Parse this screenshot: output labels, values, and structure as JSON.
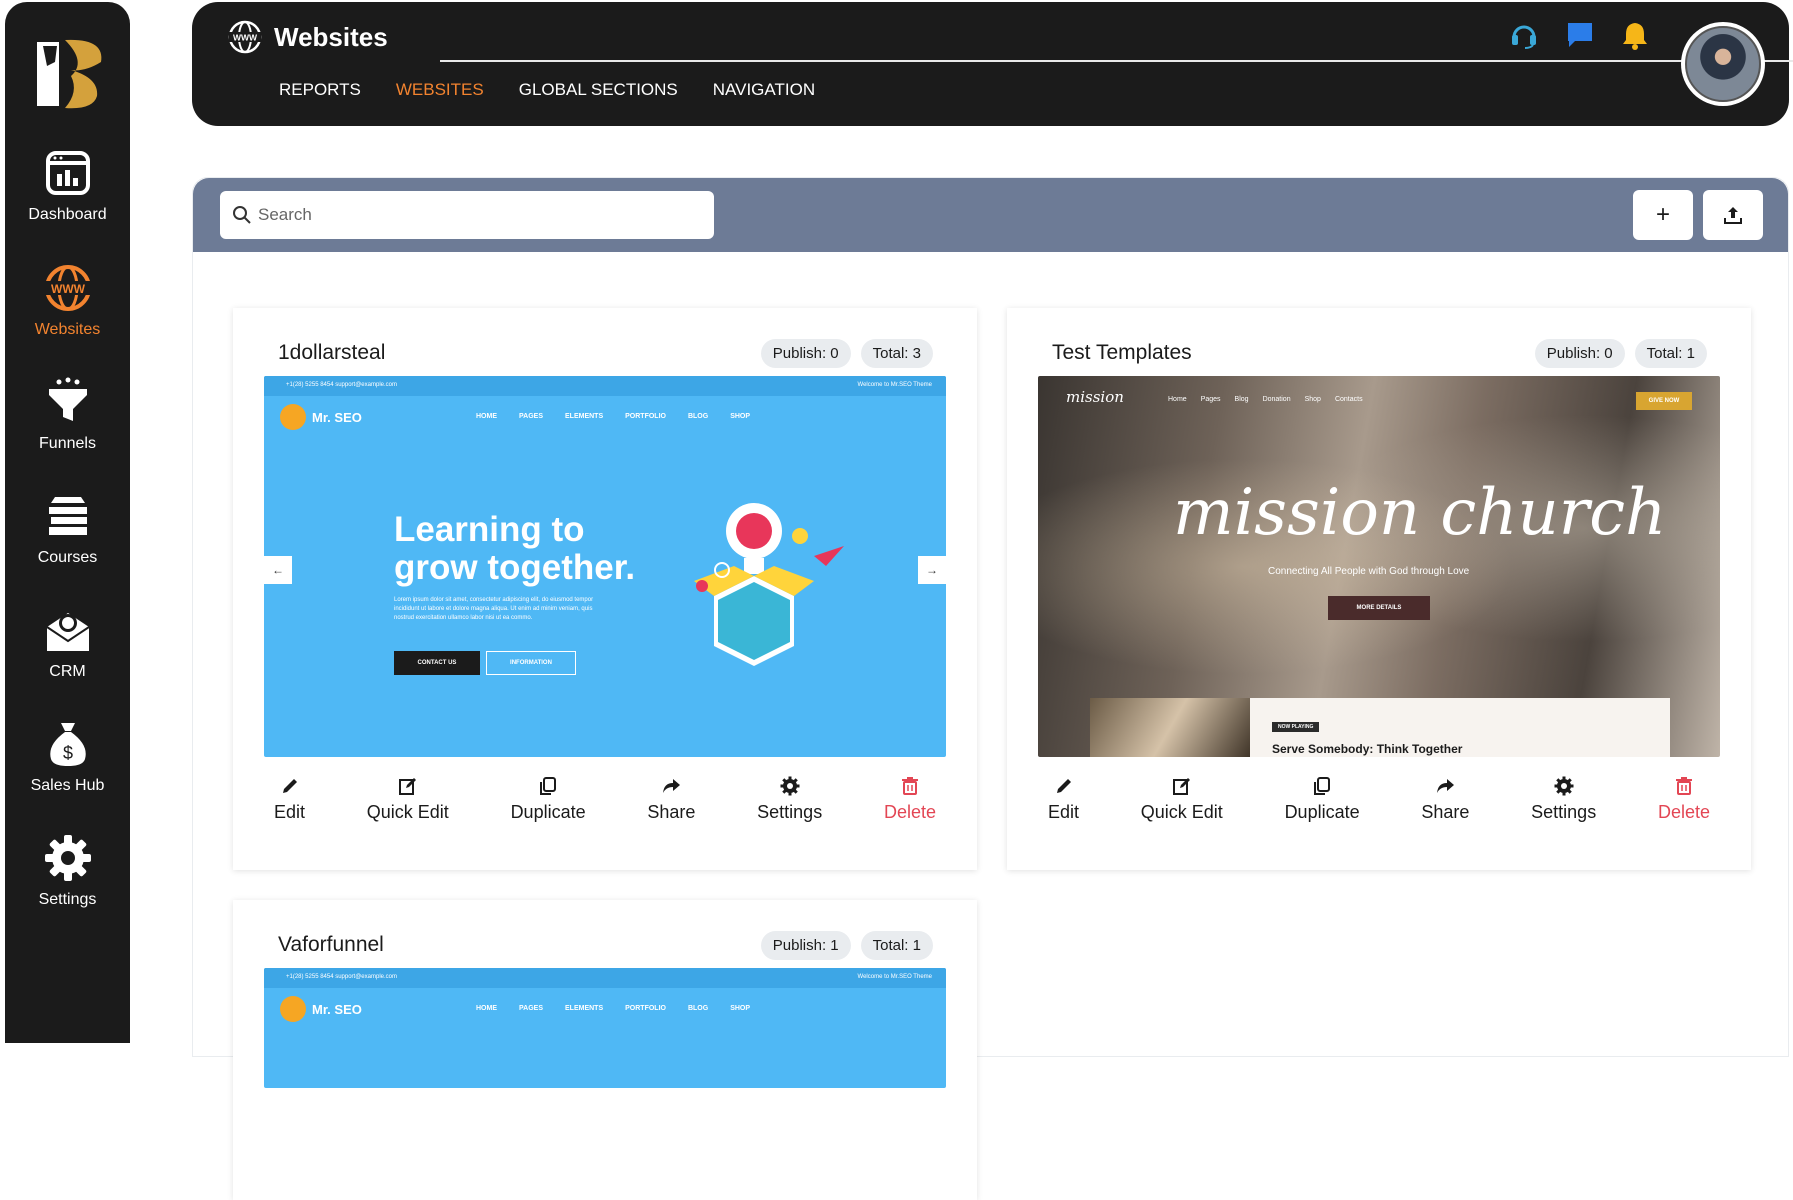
{
  "sidebar": {
    "items": [
      {
        "label": "Dashboard",
        "icon": "dashboard-icon"
      },
      {
        "label": "Websites",
        "icon": "www-globe-icon",
        "active": true
      },
      {
        "label": "Funnels",
        "icon": "funnel-icon"
      },
      {
        "label": "Courses",
        "icon": "books-icon"
      },
      {
        "label": "CRM",
        "icon": "crm-envelope-icon"
      },
      {
        "label": "Sales Hub",
        "icon": "money-bag-icon"
      },
      {
        "label": "Settings",
        "icon": "gear-icon"
      }
    ]
  },
  "header": {
    "title": "Websites",
    "tabs": [
      {
        "label": "REPORTS"
      },
      {
        "label": "WEBSITES",
        "active": true
      },
      {
        "label": "GLOBAL SECTIONS"
      },
      {
        "label": "NAVIGATION"
      }
    ]
  },
  "toolbar": {
    "search_placeholder": "Search",
    "add_label": "+",
    "upload_icon": "upload-icon"
  },
  "actions": {
    "edit": "Edit",
    "quick_edit": "Quick Edit",
    "duplicate": "Duplicate",
    "share": "Share",
    "settings": "Settings",
    "delete": "Delete"
  },
  "cards": [
    {
      "title": "1dollarsteal",
      "publish": "Publish: 0",
      "total": "Total: 3"
    },
    {
      "title": "Test Templates",
      "publish": "Publish: 0",
      "total": "Total: 1"
    },
    {
      "title": "Vaforfunnel",
      "publish": "Publish: 1",
      "total": "Total: 1"
    }
  ],
  "seo_preview": {
    "brand": "Mr. SEO",
    "menu": [
      "HOME",
      "PAGES",
      "ELEMENTS",
      "PORTFOLIO",
      "BLOG",
      "SHOP"
    ],
    "headline_1": "Learning to",
    "headline_2": "grow together.",
    "paragraph": "Lorem ipsum dolor sit amet, consectetur adipiscing elit, do eiusmod tempor incididunt ut labore et dolore magna aliqua. Ut enim ad minim veniam, quis nostrud exercitation ullamco labor nisi ut ea commo.",
    "btn_contact": "CONTACT US",
    "btn_info": "INFORMATION",
    "topbar_left": "+1(28) 5255 8454   support@example.com",
    "topbar_right": "Welcome to Mr.SEO Theme"
  },
  "church_preview": {
    "logo": "mission",
    "menu": [
      "Home",
      "Pages",
      "Blog",
      "Donation",
      "Shop",
      "Contacts"
    ],
    "give": "GIVE NOW",
    "script": "mission church",
    "tagline": "Connecting All People with God through Love",
    "more": "MORE DETAILS",
    "now_playing": "NOW PLAYING",
    "sermon": "Serve Somebody: Think Together"
  },
  "colors": {
    "dark": "#1b1b1b",
    "accent": "#f2832f",
    "toolbar": "#6d7b96",
    "delete": "#e34654",
    "badge": "#e9ecef"
  }
}
